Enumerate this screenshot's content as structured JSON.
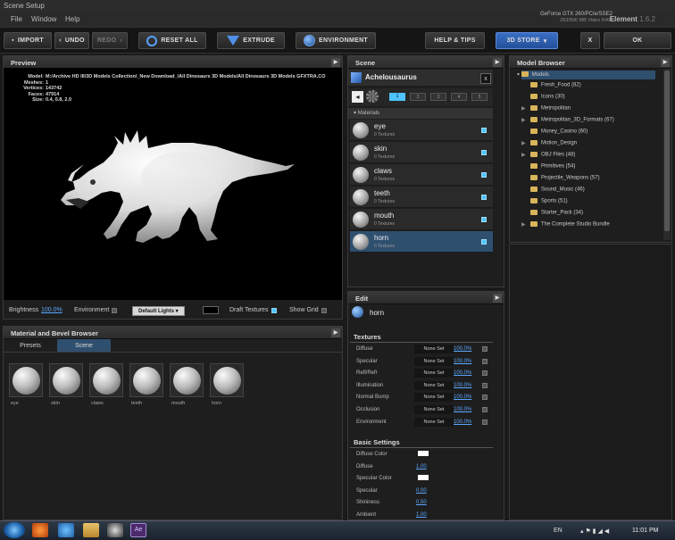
{
  "window": {
    "title": "Scene Setup"
  },
  "menu": [
    "File",
    "Window",
    "Help"
  ],
  "gpu": {
    "line1": "GeForce GTX 260/PCIe/SSE2",
    "line2": "283/896 MB Video RAM"
  },
  "app": {
    "name": "Element",
    "version": "1.6.2"
  },
  "toolbar": {
    "import": "IMPORT",
    "undo": "UNDO",
    "redo": "REDO",
    "reset_all": "RESET ALL",
    "extrude": "EXTRUDE",
    "environment": "ENVIRONMENT",
    "help_tips": "HELP & TIPS",
    "store": "3D STORE",
    "close": "X",
    "ok": "OK"
  },
  "preview": {
    "title": "Preview",
    "model_label": "Model:",
    "model": "M:/Archive HD III/3D Models Collection/_New Download_/All Dinosaurs 3D Models/All Dinosaurs 3D Models GFXTRA.CO",
    "meshes_label": "Meshes:",
    "meshes": "1",
    "vertices_label": "Vertices:",
    "vertices": "143742",
    "faces_label": "Faces:",
    "faces": "47914",
    "size_label": "Size:",
    "size": "0.4, 0.8, 2.0",
    "brightness_label": "Brightness",
    "brightness": "100.0%",
    "environment_label": "Environment",
    "lights": "Default Lights",
    "draft_label": "Draft Textures",
    "grid_label": "Show Grid"
  },
  "mat_browser": {
    "title": "Material and Bevel Browser",
    "tabs": [
      "Presets",
      "Scene"
    ],
    "active_tab": "Scene",
    "swatches": [
      "eye",
      "skin",
      "claws",
      "teeth",
      "mouth",
      "horn"
    ]
  },
  "scene": {
    "title": "Scene",
    "object": "Achelousaurus",
    "groups": [
      "1",
      "2",
      "3",
      "4",
      "5"
    ],
    "active_group": "1",
    "materials_label": "Materials",
    "materials": [
      {
        "name": "eye",
        "sub": "0 Textures"
      },
      {
        "name": "skin",
        "sub": "0 Textures"
      },
      {
        "name": "claws",
        "sub": "0 Textures"
      },
      {
        "name": "teeth",
        "sub": "0 Textures"
      },
      {
        "name": "mouth",
        "sub": "0 Textures"
      },
      {
        "name": "horn",
        "sub": "0 Textures"
      }
    ],
    "selected": "horn"
  },
  "edit": {
    "title": "Edit",
    "material": "horn",
    "textures_label": "Textures",
    "textures": [
      {
        "label": "Diffuse",
        "value": "None Set",
        "pct": "100.0%"
      },
      {
        "label": "Specular",
        "value": "None Set",
        "pct": "100.0%"
      },
      {
        "label": "Refl/Refr",
        "value": "None Set",
        "pct": "100.0%"
      },
      {
        "label": "Illumination",
        "value": "None Set",
        "pct": "100.0%"
      },
      {
        "label": "Normal Bump",
        "value": "None Set",
        "pct": "100.0%"
      },
      {
        "label": "Occlusion",
        "value": "None Set",
        "pct": "100.0%"
      },
      {
        "label": "Environment",
        "value": "None Set",
        "pct": "100.0%"
      }
    ],
    "basic_label": "Basic Settings",
    "basic": [
      {
        "label": "Diffuse Color",
        "color": "#ffffff"
      },
      {
        "label": "Diffuse",
        "value": "1.00"
      },
      {
        "label": "Specular Color",
        "color": "#ffffff"
      },
      {
        "label": "Specular",
        "value": "0.00"
      },
      {
        "label": "Shininess",
        "value": "0.50"
      },
      {
        "label": "Ambient",
        "value": "1.00"
      }
    ]
  },
  "model_browser": {
    "title": "Model Browser",
    "root": "Models",
    "items": [
      {
        "label": "Fresh_Food (82)",
        "exp": false
      },
      {
        "label": "Icons (30)",
        "exp": false
      },
      {
        "label": "Metropolitan",
        "exp": true
      },
      {
        "label": "Metropolitan_3D_Formats (67)",
        "exp": true
      },
      {
        "label": "Money_Casino (60)",
        "exp": false
      },
      {
        "label": "Motion_Design",
        "exp": true
      },
      {
        "label": "OBJ Files (48)",
        "exp": true
      },
      {
        "label": "Primitives (54)",
        "exp": false
      },
      {
        "label": "Projectile_Weapons (57)",
        "exp": false
      },
      {
        "label": "Sound_Music (46)",
        "exp": false
      },
      {
        "label": "Sports (51)",
        "exp": false
      },
      {
        "label": "Starter_Pack (34)",
        "exp": false
      },
      {
        "label": "The Complete Studio Bundle",
        "exp": true
      }
    ]
  },
  "taskbar": {
    "lang": "EN",
    "time": "11:01 PM"
  }
}
